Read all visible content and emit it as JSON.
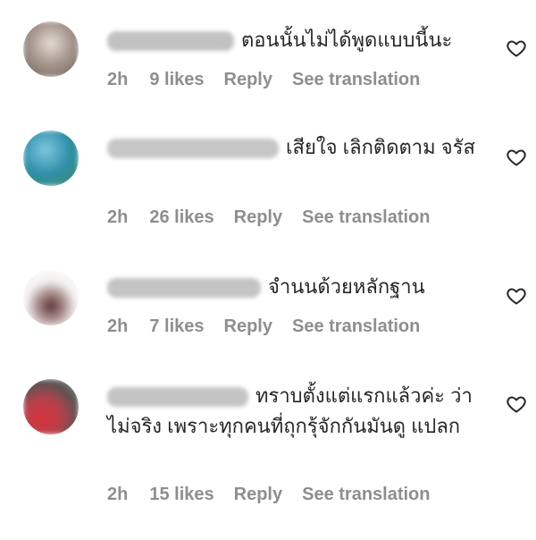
{
  "comments": [
    {
      "text": "ตอนนั้นไม่ได้พูดแบบนี้นะ",
      "time": "2h",
      "likes": "9 likes",
      "reply": "Reply",
      "translate": "See translation",
      "avatar_colors": [
        "#8a7a70",
        "#cfc6bf"
      ]
    },
    {
      "text": "เสียใจ เลิกติดตาม จรัส",
      "time": "2h",
      "likes": "26 likes",
      "reply": "Reply",
      "translate": "See translation",
      "avatar_colors": [
        "#2d8fa6",
        "#6fb38a"
      ]
    },
    {
      "text": "จำนนด้วยหลักฐาน",
      "time": "2h",
      "likes": "7 likes",
      "reply": "Reply",
      "translate": "See translation",
      "avatar_colors": [
        "#f2eeee",
        "#6b4a4a"
      ]
    },
    {
      "text": "ทราบตั้งแต่แรกแล้วค่ะ ว่าไม่จริง เพราะทุกคนที่ถุกรุ้จักกันมันดู แปลก",
      "time": "2h",
      "likes": "15 likes",
      "reply": "Reply",
      "translate": "See translation",
      "avatar_colors": [
        "#c8333d",
        "#3a3a3a"
      ]
    }
  ],
  "icons": {
    "like": "heart-outline-icon"
  },
  "colors": {
    "text": "#262626",
    "meta": "#8e8e8e",
    "username_blur": "#bfbfbf"
  }
}
